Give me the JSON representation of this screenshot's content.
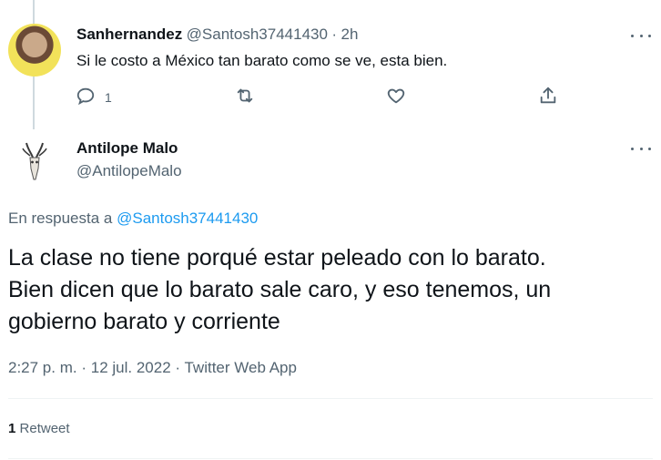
{
  "reply": {
    "display_name": "Sanhernandez",
    "handle": "@Santosh37441430",
    "separator": "·",
    "time": "2h",
    "text": "Si le costo a México tan barato como se ve, esta bien.",
    "reply_count": "1",
    "icons": [
      "reply-icon",
      "retweet-icon",
      "like-icon",
      "share-icon",
      "more-icon"
    ]
  },
  "tweet": {
    "display_name": "Antilope Malo",
    "handle": "@AntilopeMalo",
    "replying_prefix": "En respuesta a",
    "replying_to": "@Santosh37441430",
    "text_line1": "La clase no tiene porqué estar peleado con lo barato.",
    "text_line2": "Bien dicen que lo barato sale caro, y eso tenemos, un",
    "text_line3": "gobierno barato y corriente",
    "time": "2:27 p. m.",
    "date": "12 jul. 2022",
    "source": "Twitter Web App",
    "separator": "·",
    "retweet_count": "1",
    "retweet_label": "Retweet"
  },
  "colors": {
    "text": "#0f1419",
    "secondary": "#536471",
    "link": "#1d9bf0",
    "border": "#eff3f4"
  }
}
